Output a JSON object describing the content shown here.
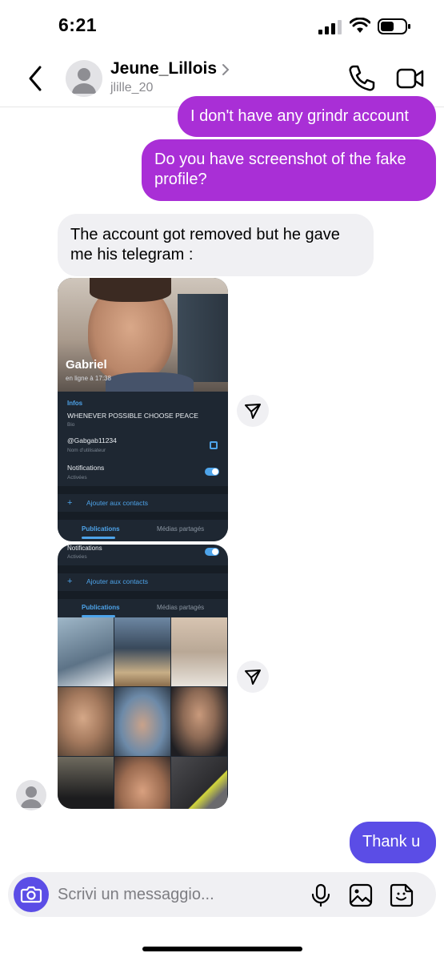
{
  "status": {
    "time": "6:21"
  },
  "header": {
    "contact_name": "Jeune_Lillois",
    "contact_handle": "jlille_20",
    "icons": [
      "back-chevron-icon",
      "avatar-icon",
      "chevron-right-icon",
      "phone-icon",
      "video-camera-icon"
    ]
  },
  "messages": [
    {
      "direction": "outgoing",
      "text": "I don't have any grindr account"
    },
    {
      "direction": "outgoing",
      "text": "Do you have screenshot of the fake profile?"
    },
    {
      "direction": "incoming",
      "text": "The account got removed but he gave me his telegram :"
    },
    {
      "direction": "outgoing",
      "text": "Thank u"
    }
  ],
  "telegram_card": {
    "name": "Gabriel",
    "status": "en ligne à 17:38",
    "infos_label": "Infos",
    "bio": "WHENEVER POSSIBLE CHOOSE PEACE",
    "bio_label": "Bio",
    "username": "@Gabgab11234",
    "username_label": "Nom d'utilisateur",
    "notifications": "Notifications",
    "notifications_status": "Activées",
    "add_contact": "Ajouter aux contacts",
    "tab_publications": "Publications",
    "tab_media": "Médias partagés"
  },
  "composer": {
    "placeholder": "Scrivi un messaggio...",
    "icons": [
      "camera-icon",
      "microphone-icon",
      "gallery-icon",
      "sticker-icon"
    ]
  },
  "colors": {
    "outgoing_bubble": "#a92fd6",
    "last_outgoing_bubble": "#5b4de6",
    "incoming_bubble": "#f0f0f3",
    "telegram_accent": "#4ea4ea"
  }
}
